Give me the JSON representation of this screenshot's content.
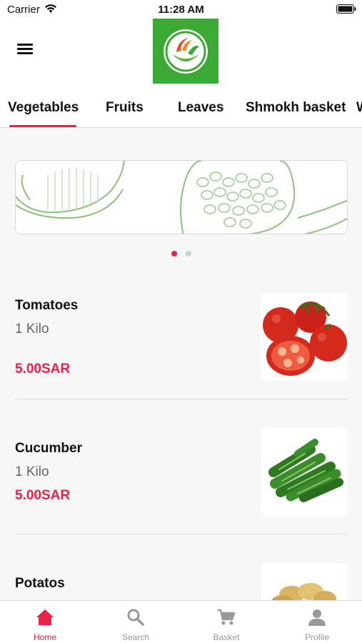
{
  "status_bar": {
    "carrier": "Carrier",
    "time": "11:28 AM"
  },
  "header": {
    "menu_icon": "hamburger-menu-icon",
    "logo": "brand-logo"
  },
  "tabs": [
    {
      "label": "Vegetables",
      "active": true
    },
    {
      "label": "Fruits",
      "active": false
    },
    {
      "label": "Leaves",
      "active": false
    },
    {
      "label": "Shmokh basket",
      "active": false
    },
    {
      "label": "W",
      "active": false
    }
  ],
  "banner": {
    "slides": 2,
    "active_slide": 1
  },
  "products": [
    {
      "name": "Tomatoes",
      "quantity": "1 Kilo",
      "price": "5.00SAR",
      "image": "tomatoes-image"
    },
    {
      "name": "Cucumber",
      "quantity": "1 Kilo",
      "price": "5.00SAR",
      "image": "cucumber-image"
    },
    {
      "name": "Potatos",
      "quantity": "",
      "price": "",
      "image": "potatoes-image"
    }
  ],
  "bottom_nav": [
    {
      "label": "Home",
      "icon": "home-icon",
      "active": true
    },
    {
      "label": "Search",
      "icon": "search-icon",
      "active": false
    },
    {
      "label": "Basket",
      "icon": "cart-icon",
      "active": false
    },
    {
      "label": "Profile",
      "icon": "profile-icon",
      "active": false
    }
  ],
  "colors": {
    "accent": "#e8234a",
    "brand_green": "#3aaa35",
    "background": "#f7f7f7"
  }
}
